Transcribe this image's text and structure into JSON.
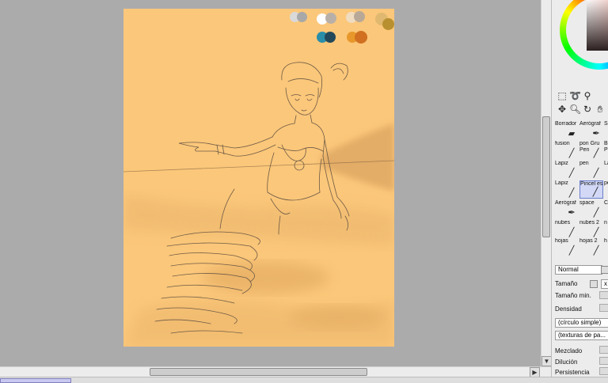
{
  "canvas": {
    "swatches_row1": [
      "#d9d9d9",
      "#a8a8a8",
      "#ffffff",
      "#b8b0a8",
      "#f0dcc0",
      "#b8a898",
      "#e0b870",
      "#b89030"
    ],
    "swatches_row2": [
      "#2a8ea8",
      "#23485a",
      "#e8982a",
      "#d07020"
    ],
    "background_color": "#fbc77a"
  },
  "tools": {
    "selection": [
      "rect-select-icon",
      "lasso-icon",
      "magic-wand-icon"
    ],
    "navigation": [
      "move-icon",
      "zoom-icon",
      "rotate-icon",
      "hand-icon"
    ]
  },
  "brushes": [
    {
      "label": "Borrador",
      "icon": "eraser-icon"
    },
    {
      "label": "Aerógraf",
      "icon": "airbrush-icon"
    },
    {
      "label": "S",
      "icon": "brush-icon"
    },
    {
      "label": "fusion",
      "icon": "pen-icon"
    },
    {
      "label": "pon Gru\nPen",
      "icon": "pen-icon"
    },
    {
      "label": "B\nP",
      "icon": "brush-icon"
    },
    {
      "label": "Lapiz",
      "icon": "pencil-icon"
    },
    {
      "label": "pen",
      "icon": "pen-icon"
    },
    {
      "label": "La",
      "icon": "pencil-icon"
    },
    {
      "label": "Lapiz",
      "icon": "pencil-icon"
    },
    {
      "label": "Pincel es",
      "icon": "brush-icon"
    },
    {
      "label": "pe",
      "icon": "pen-icon"
    },
    {
      "label": "Aerógraf",
      "icon": "airbrush-icon"
    },
    {
      "label": "space",
      "icon": "pen-icon"
    },
    {
      "label": "C",
      "icon": "brush-icon"
    },
    {
      "label": "nubes",
      "icon": "brush-icon"
    },
    {
      "label": "nubes 2",
      "icon": "brush-icon"
    },
    {
      "label": "n",
      "icon": "brush-icon"
    },
    {
      "label": "hojas",
      "icon": "pencil-icon"
    },
    {
      "label": "hojas 2",
      "icon": "pencil-icon"
    },
    {
      "label": "h",
      "icon": "pencil-icon"
    }
  ],
  "settings": {
    "blend_mode": "Normal",
    "size_label": "Tamaño",
    "size_value": "x 5",
    "min_size_label": "Tamaño min.",
    "density_label": "Densidad",
    "shape": "(círculo simple)",
    "texture": "(texturas de pa...",
    "mix_label": "Mezclado",
    "dilution_label": "Dilución",
    "persistence_label": "Persistencia"
  }
}
